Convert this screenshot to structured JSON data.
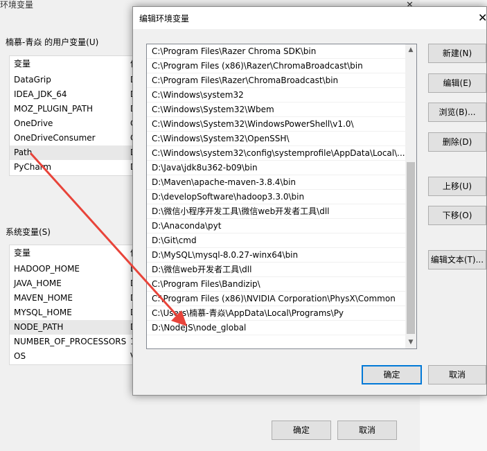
{
  "bg_dialog": {
    "title": "环境变量",
    "close_glyph": "✕",
    "user_vars_label": "楠慕-青焱 的用户变量(U)",
    "user_vars_header": [
      "变量",
      "值"
    ],
    "user_vars": [
      {
        "name": "DataGrip",
        "value": "D"
      },
      {
        "name": "IDEA_JDK_64",
        "value": "D"
      },
      {
        "name": "MOZ_PLUGIN_PATH",
        "value": "D"
      },
      {
        "name": "OneDrive",
        "value": "C"
      },
      {
        "name": "OneDriveConsumer",
        "value": "C"
      },
      {
        "name": "Path",
        "value": "D"
      },
      {
        "name": "PyCharm",
        "value": "D"
      }
    ],
    "sys_vars_label": "系统变量(S)",
    "sys_vars_header": [
      "变量",
      "值"
    ],
    "sys_vars": [
      {
        "name": "HADOOP_HOME",
        "value": "D"
      },
      {
        "name": "JAVA_HOME",
        "value": "D"
      },
      {
        "name": "MAVEN_HOME",
        "value": "D"
      },
      {
        "name": "MYSQL_HOME",
        "value": "D"
      },
      {
        "name": "NODE_PATH",
        "value": "D"
      },
      {
        "name": "NUMBER_OF_PROCESSORS",
        "value": "1"
      },
      {
        "name": "OS",
        "value": "V"
      }
    ],
    "ok_label": "确定",
    "cancel_label": "取消"
  },
  "edit_dialog": {
    "title": "编辑环境变量",
    "close_glyph": "✕",
    "paths": [
      "C:\\Program Files\\Razer Chroma SDK\\bin",
      "C:\\Program Files (x86)\\Razer\\ChromaBroadcast\\bin",
      "C:\\Program Files\\Razer\\ChromaBroadcast\\bin",
      "C:\\Windows\\system32",
      "C:\\Windows\\System32\\Wbem",
      "C:\\Windows\\System32\\WindowsPowerShell\\v1.0\\",
      "C:\\Windows\\System32\\OpenSSH\\",
      "C:\\Windows\\system32\\config\\systemprofile\\AppData\\Local\\...",
      "D:\\Java\\jdk8u362-b09\\bin",
      "D:\\Maven\\apache-maven-3.8.4\\bin",
      "D:\\developSoftware\\hadoop3.3.0\\bin",
      "D:\\微信小程序开发工具\\微信web开发者工具\\dll",
      "D:\\Anaconda\\pyt",
      "D:\\Git\\cmd",
      "D:\\MySQL\\mysql-8.0.27-winx64\\bin",
      "D:\\微信web开发者工具\\dll",
      "C:\\Program Files\\Bandizip\\",
      "C:\\Program Files (x86)\\NVIDIA Corporation\\PhysX\\Common",
      "C:\\Users\\楠慕-青焱\\AppData\\Local\\Programs\\Py",
      "D:\\NodeJS\\node_global"
    ],
    "buttons": {
      "new": "新建(N)",
      "edit": "编辑(E)",
      "browse": "浏览(B)...",
      "delete": "删除(D)",
      "move_up": "上移(U)",
      "move_down": "下移(O)",
      "edit_text": "编辑文本(T)...",
      "ok": "确定",
      "cancel": "取消"
    }
  },
  "colors": {
    "accent": "#0078d7",
    "arrow": "#e8443a"
  },
  "icons": {
    "scroll_up": "▲",
    "scroll_down": "▼"
  }
}
